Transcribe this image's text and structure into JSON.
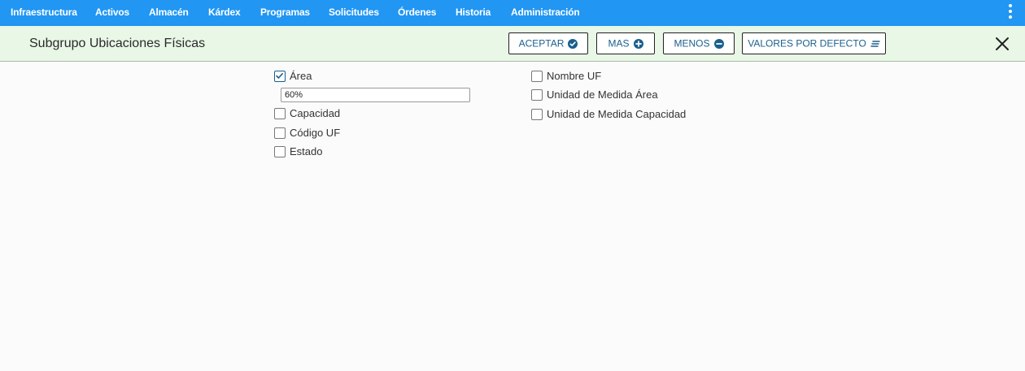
{
  "topnav": {
    "items": [
      "Infraestructura",
      "Activos",
      "Almacén",
      "Kárdex",
      "Programas",
      "Solicitudes",
      "Órdenes",
      "Historia",
      "Administración"
    ],
    "menu_icon": "more-vertical-icon"
  },
  "header": {
    "title": "Subgrupo Ubicaciones Físicas",
    "buttons": {
      "accept": {
        "label": "ACEPTAR",
        "icon": "check-circle-icon"
      },
      "more": {
        "label": "MAS",
        "icon": "plus-circle-icon"
      },
      "less": {
        "label": "MENOS",
        "icon": "minus-circle-icon"
      },
      "defaults": {
        "label": "VALORES POR DEFECTO",
        "icon": "lines-icon"
      }
    },
    "close_icon": "close-icon"
  },
  "fields": {
    "left": [
      {
        "label": "Área",
        "checked": true,
        "value": "60%"
      },
      {
        "label": "Capacidad",
        "checked": false
      },
      {
        "label": "Código UF",
        "checked": false
      },
      {
        "label": "Estado",
        "checked": false
      }
    ],
    "right": [
      {
        "label": "Nombre UF",
        "checked": false
      },
      {
        "label": "Unidad de Medida Área",
        "checked": false
      },
      {
        "label": "Unidad de Medida Capacidad",
        "checked": false
      }
    ]
  },
  "colors": {
    "topbar": "#2196f3",
    "header_bg": "#e9f7e7",
    "button_text": "#1a5f8c",
    "checkbox_accent": "#1a5f8c"
  }
}
